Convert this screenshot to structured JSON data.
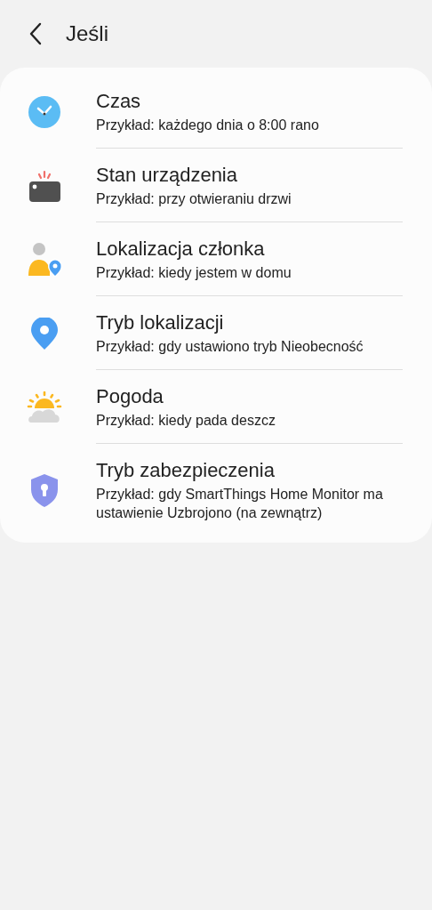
{
  "header": {
    "title": "Jeśli"
  },
  "items": [
    {
      "kind": "clock",
      "title": "Czas",
      "example": "Przykład: każdego dnia o 8:00 rano"
    },
    {
      "kind": "device",
      "title": "Stan urządzenia",
      "example": "Przykład: przy otwieraniu drzwi"
    },
    {
      "kind": "member",
      "title": "Lokalizacja członka",
      "example": "Przykład: kiedy jestem w domu"
    },
    {
      "kind": "location",
      "title": "Tryb lokalizacji",
      "example": "Przykład: gdy ustawiono tryb Nieobecność"
    },
    {
      "kind": "weather",
      "title": "Pogoda",
      "example": "Przykład: kiedy pada deszcz"
    },
    {
      "kind": "security",
      "title": "Tryb zabezpieczenia",
      "example": "Przykład: gdy SmartThings Home Monitor ma ustawienie Uzbrojono (na zewnątrz)"
    }
  ]
}
